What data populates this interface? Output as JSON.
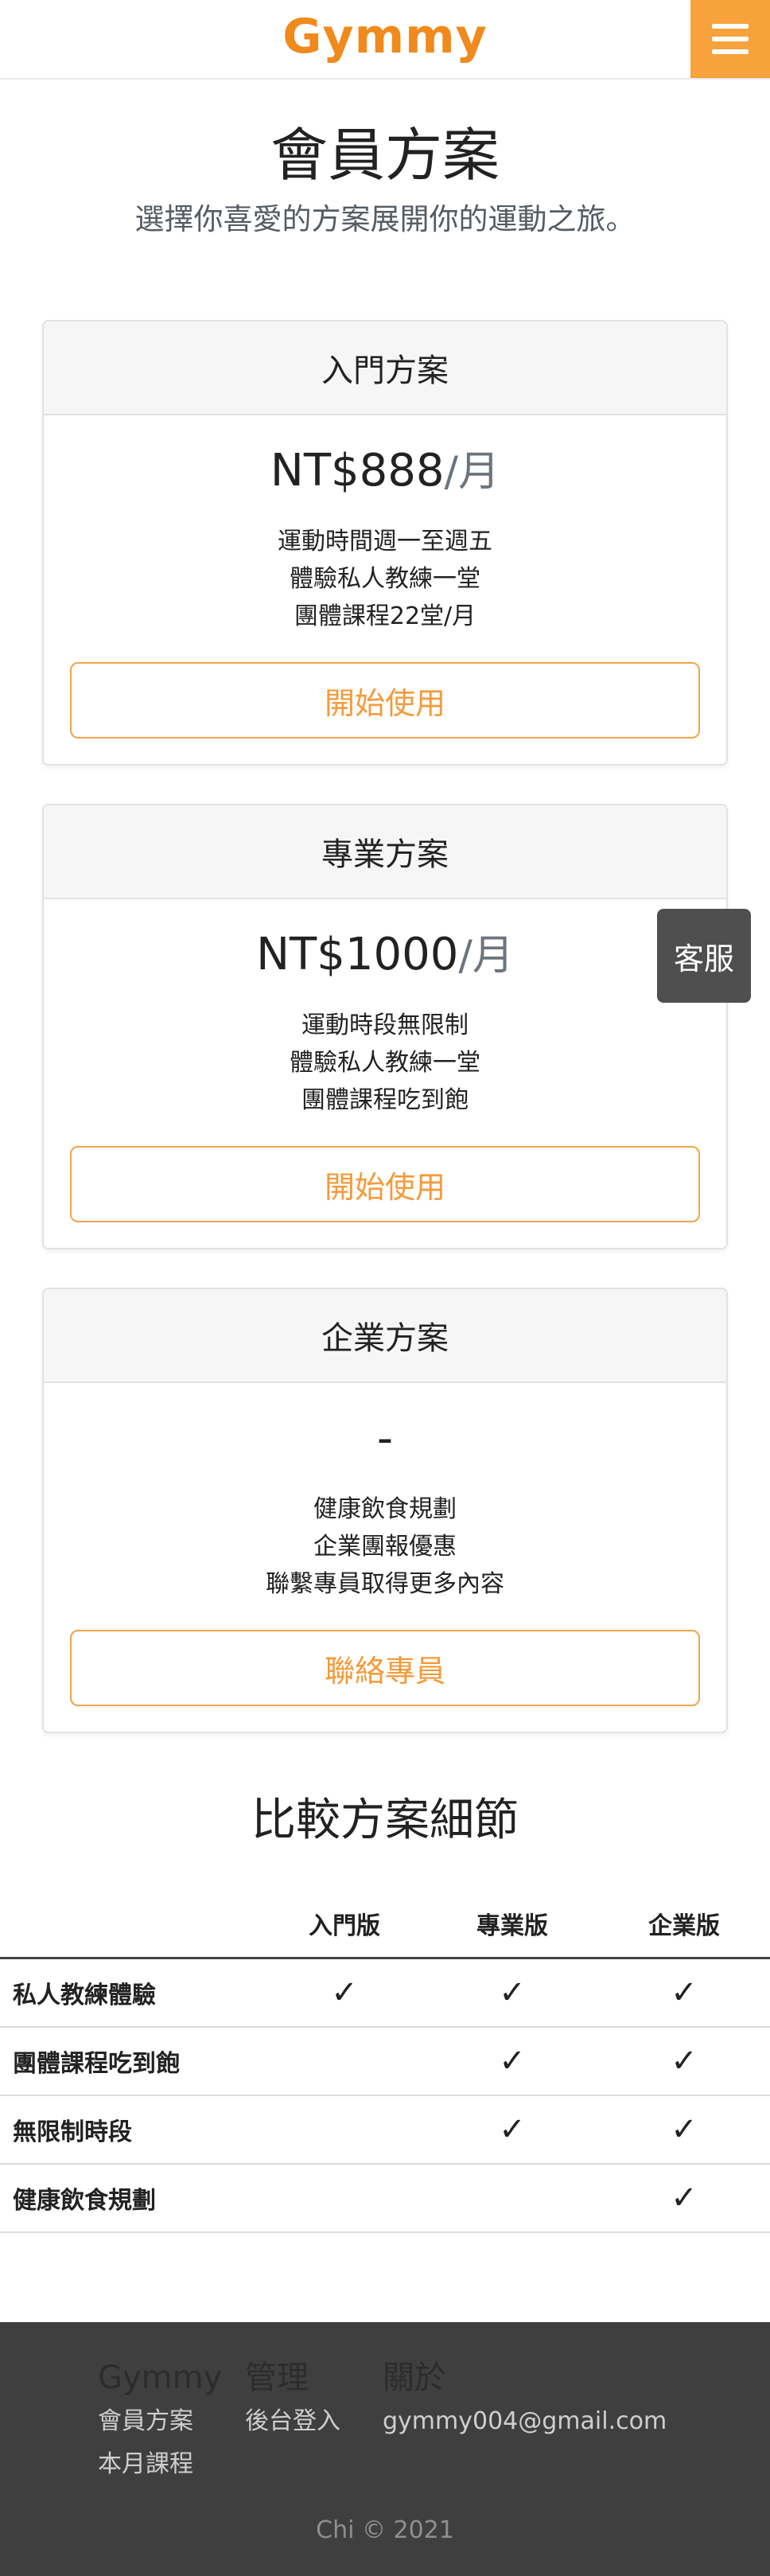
{
  "navbar": {
    "brand": "Gymmy",
    "menu_icon": "hamburger-icon"
  },
  "hero": {
    "title": "會員方案",
    "subtitle": "選擇你喜愛的方案展開你的運動之旅。"
  },
  "plans": [
    {
      "name": "入門方案",
      "price": "NT$888",
      "unit": "/月",
      "features": [
        "運動時間週一至週五",
        "體驗私人教練一堂",
        "團體課程22堂/月"
      ],
      "cta": "開始使用"
    },
    {
      "name": "專業方案",
      "price": "NT$1000",
      "unit": "/月",
      "features": [
        "運動時段無限制",
        "體驗私人教練一堂",
        "團體課程吃到飽"
      ],
      "cta": "開始使用"
    },
    {
      "name": "企業方案",
      "price": "-",
      "unit": "",
      "features": [
        "健康飲食規劃",
        "企業團報優惠",
        "聯繫專員取得更多內容"
      ],
      "cta": "聯絡專員"
    }
  ],
  "customer_service": "客服",
  "compare": {
    "title": "比較方案細節",
    "columns": [
      "",
      "入門版",
      "專業版",
      "企業版"
    ],
    "check_mark": "✓",
    "rows": [
      {
        "label": "私人教練體驗",
        "marks": [
          true,
          true,
          true
        ]
      },
      {
        "label": "團體課程吃到飽",
        "marks": [
          false,
          true,
          true
        ]
      },
      {
        "label": "無限制時段",
        "marks": [
          false,
          true,
          true
        ]
      },
      {
        "label": "健康飲食規劃",
        "marks": [
          false,
          false,
          true
        ]
      }
    ]
  },
  "footer": {
    "columns": [
      {
        "heading": "Gymmy",
        "links": [
          "會員方案",
          "本月課程"
        ]
      },
      {
        "heading": "管理",
        "links": [
          "後台登入"
        ]
      },
      {
        "heading": "關於",
        "links": [
          "gymmy004@gmail.com"
        ]
      }
    ],
    "copyright": "Chi © 2021"
  },
  "colors": {
    "accent": "#f08a1c",
    "menu_bg": "#f7a23a",
    "footer_bg": "#3f3f3f",
    "cs_bg": "#4f4f4f"
  }
}
